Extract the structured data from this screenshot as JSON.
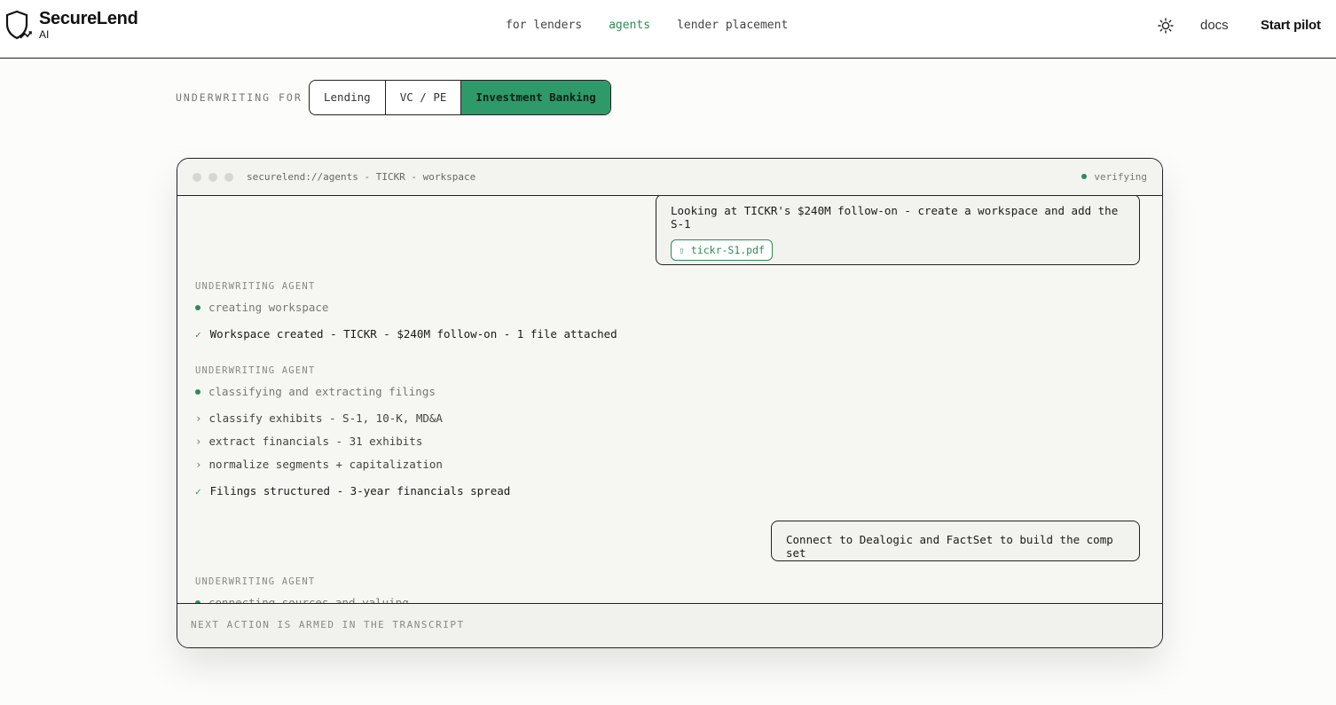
{
  "header": {
    "brand": "SecureLend",
    "brand_sub": "AI",
    "nav": [
      "for lenders",
      "agents",
      "lender placement"
    ],
    "active_nav": "agents",
    "docs": "docs",
    "cta": "Start pilot"
  },
  "underwriting": {
    "label": "UNDERWRITING FOR",
    "options": [
      "Lending",
      "VC / PE",
      "Investment Banking"
    ],
    "selected": "Investment Banking"
  },
  "window": {
    "title": "securelend://agents - TICKR - workspace",
    "status": "verifying",
    "footer": "NEXT ACTION IS ARMED IN THE TRANSCRIPT"
  },
  "transcript": {
    "user_msg_1": "Looking at TICKR's $240M follow-on - create a workspace and add the S-1",
    "attachment": "tickr-S1.pdf",
    "agent_label": "UNDERWRITING AGENT",
    "step1_status": "creating workspace",
    "step1_done": "Workspace created - TICKR - $240M follow-on - 1 file attached",
    "step2_status": "classifying and extracting filings",
    "step2_subs": [
      "classify exhibits - S-1, 10-K, MD&A",
      "extract financials - 31 exhibits",
      "normalize segments + capitalization"
    ],
    "step2_done": "Filings structured - 3-year financials spread",
    "user_msg_2": "Connect to Dealogic and FactSet to build the comp set",
    "step3_status": "connecting sources and valuing"
  },
  "colors": {
    "accent": "#2e8b57",
    "accent_fill": "#2e9a6a"
  }
}
